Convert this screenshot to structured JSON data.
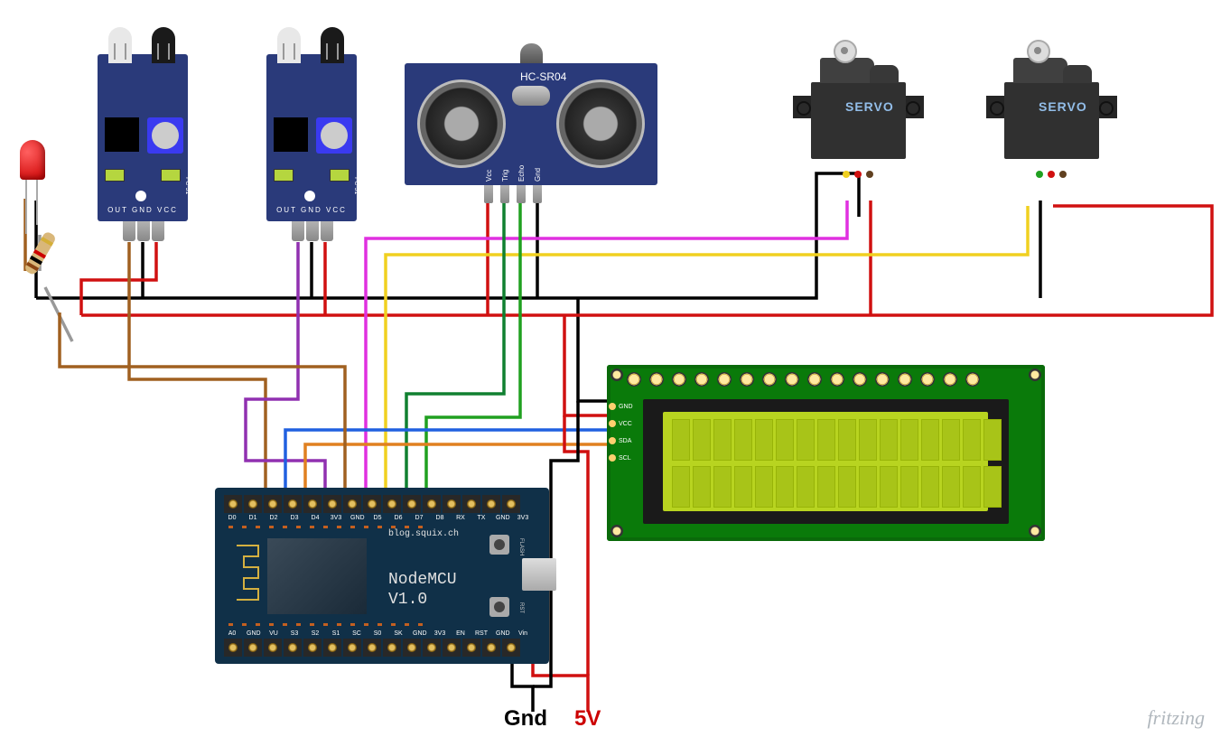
{
  "components": {
    "led_red": {
      "color": "#cc0000"
    },
    "resistor": {
      "bands": [
        "#8b4513",
        "#000",
        "#cc0000",
        "#d4af37"
      ]
    },
    "ir_module_1": {
      "pin_labels": "OUT GND VCC"
    },
    "ir_module_2": {
      "pin_labels": "OUT GND VCC"
    },
    "hcsr04": {
      "model": "HC-SR04",
      "pins": [
        "Vcc",
        "Trig",
        "Echo",
        "Gnd"
      ]
    },
    "servo_1": {
      "label": "SERVO"
    },
    "servo_2": {
      "label": "SERVO"
    },
    "lcd": {
      "side_pins": [
        "GND",
        "VCC",
        "SDA",
        "SCL"
      ],
      "cols": 16,
      "rows": 2
    },
    "nodemcu": {
      "url": "blog.squix.ch",
      "name": "NodeMCU",
      "version": "V1.0",
      "btn_flash": "FLASH",
      "btn_rst": "RST",
      "pins_top": [
        "D0",
        "D1",
        "D2",
        "D3",
        "D4",
        "3V3",
        "GND",
        "D5",
        "D6",
        "D7",
        "D8",
        "RX",
        "TX",
        "GND",
        "3V3"
      ],
      "pins_bot": [
        "A0",
        "GND",
        "VU",
        "S3",
        "S2",
        "S1",
        "SC",
        "S0",
        "SK",
        "GND",
        "3V3",
        "EN",
        "RST",
        "GND",
        "Vin"
      ]
    }
  },
  "power": {
    "gnd": "Gnd",
    "v5": "5V"
  },
  "watermark": "fritzing",
  "wiring": {
    "colors": {
      "gnd": "#000000",
      "vcc": "#d01010",
      "brown": "#a06020",
      "purple": "#9030b0",
      "magenta": "#e030e0",
      "yellow": "#f0d020",
      "green": "#20a020",
      "green2": "#108030",
      "blue": "#2060e0",
      "orange": "#e08020"
    }
  }
}
